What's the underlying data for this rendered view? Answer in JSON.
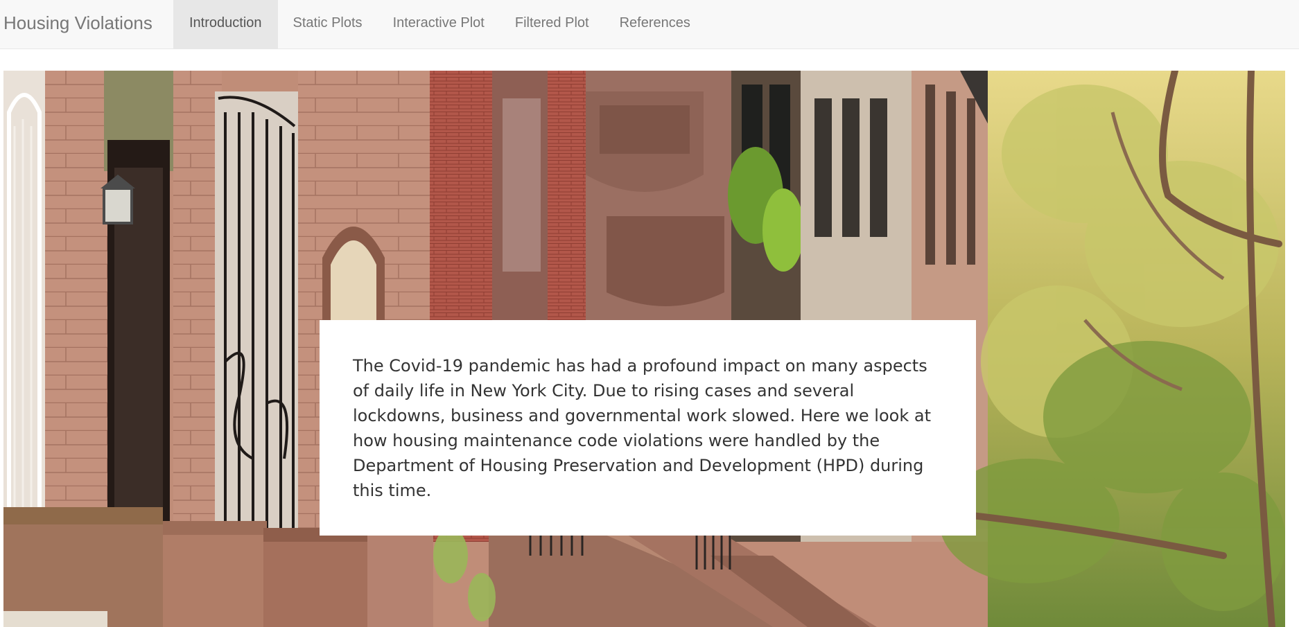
{
  "navbar": {
    "brand": "Housing Violations",
    "tabs": [
      {
        "label": "Introduction",
        "active": true
      },
      {
        "label": "Static Plots",
        "active": false
      },
      {
        "label": "Interactive Plot",
        "active": false
      },
      {
        "label": "Filtered Plot",
        "active": false
      },
      {
        "label": "References",
        "active": false
      }
    ]
  },
  "main": {
    "intro_text": "The Covid-19 pandemic has had a profound impact on many aspects of daily life in New York City. Due to rising cases and several lockdowns, business and governmental work slowed. Here we look at how housing maintenance code violations were handled by the Department of Housing Preservation and Development (HPD) during this time."
  },
  "colors": {
    "navbar_bg": "#f8f8f8",
    "active_tab_bg": "#e7e7e7",
    "nav_text": "#777777",
    "body_text": "#333333"
  }
}
